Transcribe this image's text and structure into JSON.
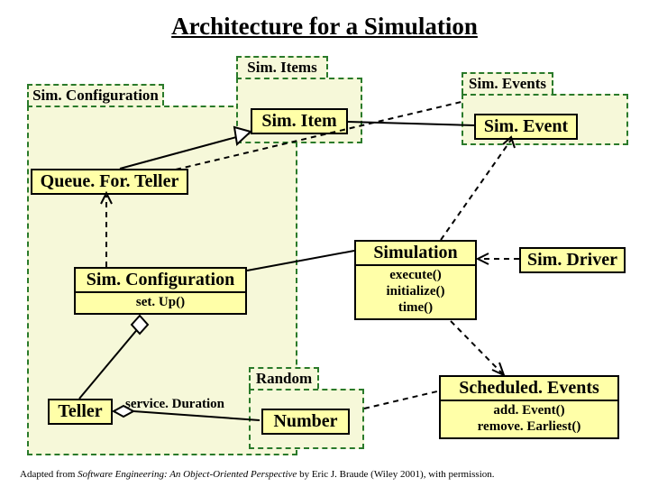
{
  "title": "Architecture for a Simulation",
  "packages": {
    "simConfiguration": "Sim. Configuration",
    "simItems": "Sim. Items",
    "simEvents": "Sim. Events",
    "random": "Random"
  },
  "classes": {
    "queueForTeller": {
      "name": "Queue. For. Teller"
    },
    "simItem": {
      "name": "Sim. Item"
    },
    "simEvent": {
      "name": "Sim. Event"
    },
    "simConfiguration": {
      "name": "Sim. Configuration",
      "ops": "set. Up()"
    },
    "simulation": {
      "name": "Simulation",
      "ops": "execute()\ninitialize()\ntime()"
    },
    "simDriver": {
      "name": "Sim. Driver"
    },
    "teller": {
      "name": "Teller"
    },
    "number": {
      "name": "Number"
    },
    "scheduledEvents": {
      "name": "Scheduled. Events",
      "ops": "add. Event()\nremove. Earliest()"
    }
  },
  "labels": {
    "serviceDuration": "service. Duration"
  },
  "footer": {
    "prefix": "Adapted from ",
    "book": "Software Engineering: An Object-Oriented Perspective",
    "suffix": " by Eric J. Braude (Wiley 2001), with permission."
  }
}
